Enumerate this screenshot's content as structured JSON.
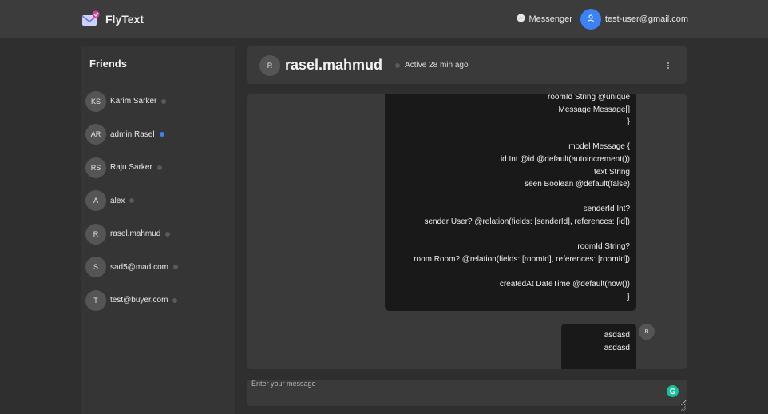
{
  "app": {
    "name": "FlyText"
  },
  "nav": {
    "messenger_label": "Messenger",
    "user_email": "test-user@gmail.com"
  },
  "sidebar": {
    "title": "Friends",
    "friends": [
      {
        "initials": "KS",
        "name": "Karim Sarker",
        "online": false
      },
      {
        "initials": "AR",
        "name": "admin Rasel",
        "online": true
      },
      {
        "initials": "RS",
        "name": "Raju Sarker",
        "online": false
      },
      {
        "initials": "A",
        "name": "alex",
        "online": false
      },
      {
        "initials": "R",
        "name": "rasel.mahmud",
        "online": false
      },
      {
        "initials": "S",
        "name": "sad5@mad.com",
        "online": false
      },
      {
        "initials": "T",
        "name": "test@buyer.com",
        "online": false
      }
    ]
  },
  "chat": {
    "avatar": "R",
    "name": "rasel.mahmud",
    "status": "Active 28 min ago",
    "code_message_lines": [
      "roomId String @unique",
      "Message Message[]",
      "}",
      "",
      "model Message {",
      "id Int @id @default(autoincrement())",
      "text String",
      "seen Boolean @default(false)",
      "",
      "senderId Int?",
      "sender User? @relation(fields: [senderId], references: [id])",
      "",
      "roomId String?",
      "room Room? @relation(fields: [roomId], references: [roomId])",
      "",
      "createdAt DateTime @default(now())",
      "}"
    ],
    "short_message_lines": [
      "asdasd",
      "asdasd"
    ],
    "message_avatar": "R"
  },
  "composer": {
    "placeholder": "Enter your message"
  },
  "colors": {
    "accent": "#3b82f6",
    "online": "#3b82f6",
    "offline": "#5a5a5a",
    "grammarly": "#15c39a"
  }
}
